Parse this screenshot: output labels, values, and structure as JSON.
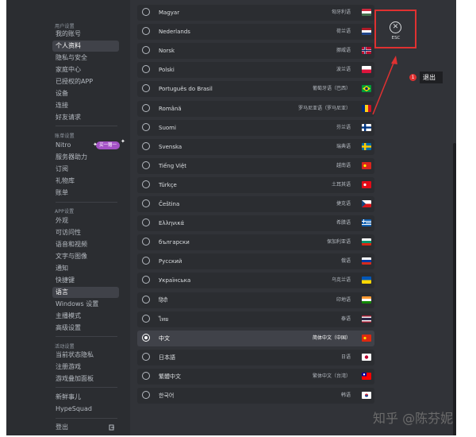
{
  "sidebar": {
    "sections": [
      {
        "header": "用户设置",
        "items": [
          "我的账号",
          "个人资料",
          "隐私与安全",
          "家庭中心",
          "已授权的APP",
          "设备",
          "连接",
          "好友请求"
        ]
      },
      {
        "header": "账单设置",
        "items": [
          "Nitro",
          "服务器助力",
          "订阅",
          "礼物库",
          "账单"
        ]
      },
      {
        "header": "APP设置",
        "items": [
          "外观",
          "可访问性",
          "语音和视频",
          "文字与图像",
          "通知",
          "快捷键",
          "语言",
          "Windows 设置",
          "主播模式",
          "高级设置"
        ]
      },
      {
        "header": "活动设置",
        "items": [
          "当前状态隐私",
          "注册游戏",
          "游戏叠加面板"
        ]
      }
    ],
    "extra_items": [
      "新鲜事儿",
      "HypeSquad"
    ],
    "logout_label": "登出",
    "nitro_badge": "买一赠一"
  },
  "languages": [
    {
      "name": "Magyar",
      "native": "匈牙利语",
      "flag": "hu"
    },
    {
      "name": "Nederlands",
      "native": "荷兰语",
      "flag": "nl"
    },
    {
      "name": "Norsk",
      "native": "挪威语",
      "flag": "no"
    },
    {
      "name": "Polski",
      "native": "波兰语",
      "flag": "pl"
    },
    {
      "name": "Português do Brasil",
      "native": "葡萄牙语（巴西）",
      "flag": "br"
    },
    {
      "name": "Română",
      "native": "罗马尼亚语（罗马尼亚）",
      "flag": "ro"
    },
    {
      "name": "Suomi",
      "native": "芬兰语",
      "flag": "fi"
    },
    {
      "name": "Svenska",
      "native": "瑞典语",
      "flag": "se"
    },
    {
      "name": "Tiếng Việt",
      "native": "越南语",
      "flag": "vn"
    },
    {
      "name": "Türkçe",
      "native": "土耳其语",
      "flag": "tr"
    },
    {
      "name": "Čeština",
      "native": "捷克语",
      "flag": "cz"
    },
    {
      "name": "Ελληνικά",
      "native": "希腊语",
      "flag": "gr"
    },
    {
      "name": "български",
      "native": "保加利亚语",
      "flag": "bg"
    },
    {
      "name": "Русский",
      "native": "俄语",
      "flag": "ru"
    },
    {
      "name": "Українська",
      "native": "乌克兰语",
      "flag": "ua"
    },
    {
      "name": "हिंदी",
      "native": "印地语",
      "flag": "in"
    },
    {
      "name": "ไทย",
      "native": "泰语",
      "flag": "th"
    },
    {
      "name": "中文",
      "native": "简体中文（中国）",
      "flag": "cn",
      "selected": true
    },
    {
      "name": "日本語",
      "native": "日语",
      "flag": "jp"
    },
    {
      "name": "繁體中文",
      "native": "繁体中文（台湾）",
      "flag": "tw"
    },
    {
      "name": "한국어",
      "native": "韩语",
      "flag": "kr"
    }
  ],
  "close": {
    "label": "ESC"
  },
  "annotation": {
    "number": "1",
    "label": "退出"
  },
  "watermark": "知乎 @陈芬妮",
  "colors": {
    "accent_red": "#e03131",
    "background": "#313338",
    "sidebar": "#2b2d31",
    "selected_row": "#404249",
    "nitro_badge": "#a452c6"
  }
}
